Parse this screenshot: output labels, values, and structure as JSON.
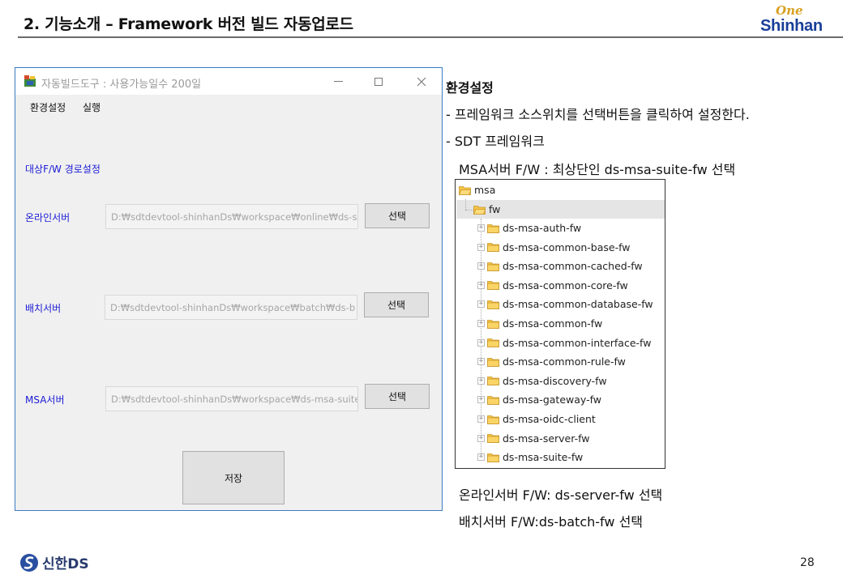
{
  "slide": {
    "title": "2. 기능소개 – Framework 버전 빌드 자동업로드",
    "logo_one": "One",
    "logo_main": "Shinhan",
    "page_number": "28",
    "footer_brand": "신한DS"
  },
  "app": {
    "window_title": "자동빌드도구 : 사용가능일수 200일",
    "menu": [
      "환경설정",
      "실행"
    ],
    "section_label": "대상F/W 경로설정",
    "rows": [
      {
        "label": "온라인서버",
        "path": "D:₩sdtdevtool-shinhanDs₩workspace₩online₩ds-s",
        "button": "선택"
      },
      {
        "label": "배치서버",
        "path": "D:₩sdtdevtool-shinhanDs₩workspace₩batch₩ds-b",
        "button": "선택"
      },
      {
        "label": "MSA서버",
        "path": "D:₩sdtdevtool-shinhanDs₩workspace₩ds-msa-suite",
        "button": "선택"
      }
    ],
    "save_button": "저장"
  },
  "notes": {
    "heading": "환경설정",
    "line1": "- 프레임워크 소스위치를 선택버튼을 클릭하여 설정한다.",
    "line2": "- SDT 프레임워크",
    "line3": "MSA서버 F/W : 최상단인 ds-msa-suite-fw 선택",
    "line4": "온라인서버 F/W: ds-server-fw 선택",
    "line5": "배치서버 F/W:ds-batch-fw 선택"
  },
  "tree": {
    "root": "msa",
    "child": "fw",
    "items": [
      "ds-msa-auth-fw",
      "ds-msa-common-base-fw",
      "ds-msa-common-cached-fw",
      "ds-msa-common-core-fw",
      "ds-msa-common-database-fw",
      "ds-msa-common-fw",
      "ds-msa-common-interface-fw",
      "ds-msa-common-rule-fw",
      "ds-msa-discovery-fw",
      "ds-msa-gateway-fw",
      "ds-msa-oidc-client",
      "ds-msa-server-fw",
      "ds-msa-suite-fw"
    ]
  },
  "colors": {
    "window_border": "#3a7cc4",
    "label_blue": "#1b1bd6",
    "folder_yellow": "#f5c445",
    "logo_blue": "#1a3f99",
    "logo_gold": "#d8a020"
  }
}
